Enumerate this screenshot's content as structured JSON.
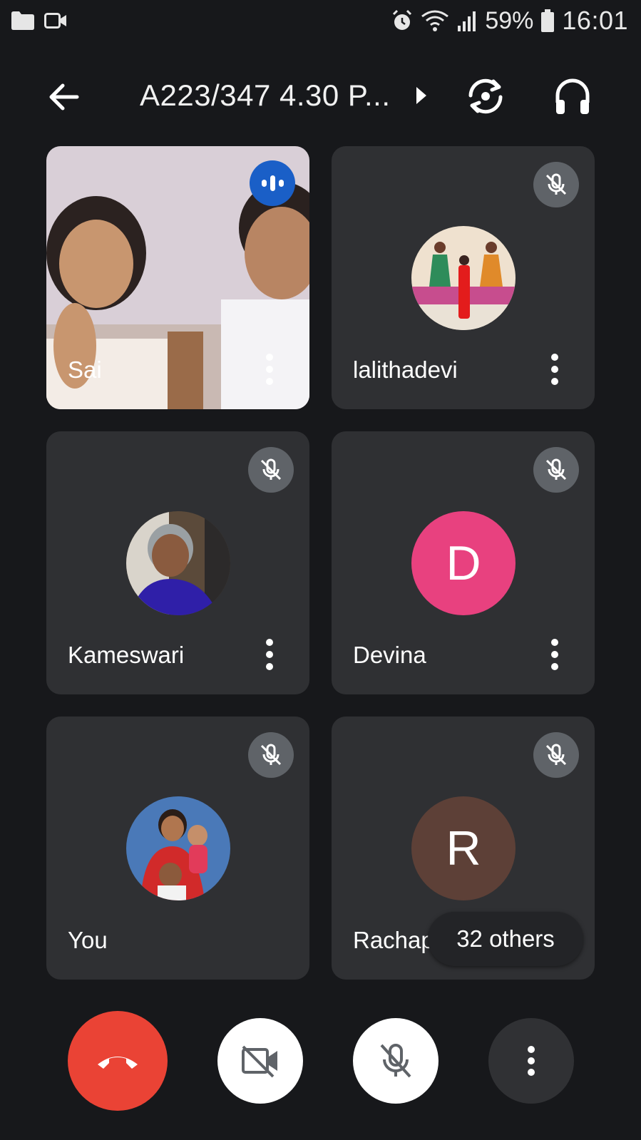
{
  "status_bar": {
    "battery_percent": "59%",
    "time": "16:01",
    "icons": [
      "folder-icon",
      "video-icon",
      "alarm-icon",
      "wifi-icon",
      "signal-icon",
      "battery-icon"
    ]
  },
  "header": {
    "title": "A223/347 4.30 P...",
    "icons": [
      "back-arrow-icon",
      "caret-right-icon",
      "switch-camera-icon",
      "headphones-icon"
    ]
  },
  "participants": [
    {
      "name": "Sai",
      "type": "video",
      "speaking": true
    },
    {
      "name": "lalithadevi",
      "type": "photo",
      "muted": true
    },
    {
      "name": "Kameswari",
      "type": "photo",
      "muted": true
    },
    {
      "name": "Devina",
      "type": "initial",
      "initial": "D",
      "color": "#e8417f",
      "muted": true
    },
    {
      "name": "You",
      "type": "photo",
      "muted": true
    },
    {
      "name": "Rachap",
      "type": "initial",
      "initial": "R",
      "color": "#5d4037",
      "muted": true
    }
  ],
  "others_chip": "32 others",
  "controls": {
    "end_call_color": "#ea4335",
    "icons": [
      "end-call-icon",
      "camera-off-icon",
      "mic-off-icon",
      "more-options-icon"
    ]
  }
}
